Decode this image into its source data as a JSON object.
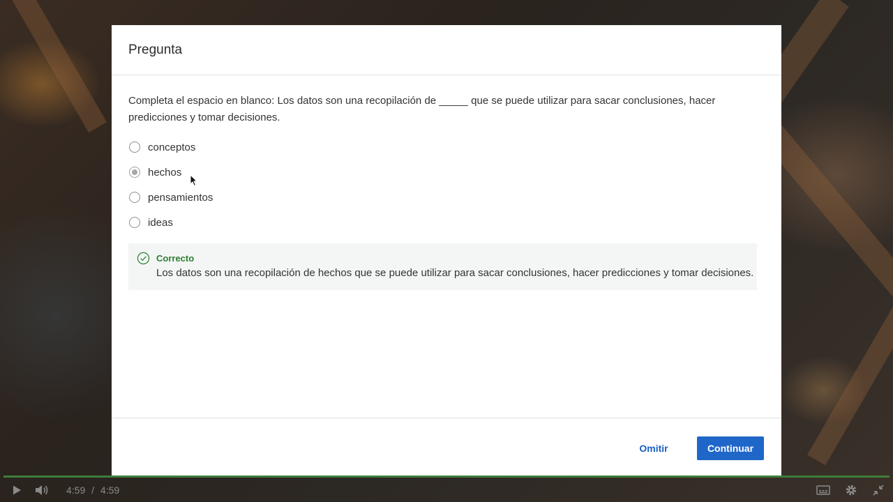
{
  "modal": {
    "title": "Pregunta",
    "question": "Completa el espacio en blanco: Los datos son una recopilación de _____ que se puede utilizar para sacar conclusiones, hacer predicciones y tomar decisiones.",
    "options": [
      {
        "label": "conceptos",
        "selected": false
      },
      {
        "label": "hechos",
        "selected": true
      },
      {
        "label": "pensamientos",
        "selected": false
      },
      {
        "label": "ideas",
        "selected": false
      }
    ],
    "feedback": {
      "title": "Correcto",
      "text": "Los datos son una recopilación de hechos que se puede utilizar para sacar conclusiones, hacer predicciones y tomar decisiones.",
      "icon": "check-circle-icon",
      "color": "#2e7d32"
    },
    "buttons": {
      "skip": "Omitir",
      "continue": "Continuar"
    }
  },
  "player": {
    "current_time": "4:59",
    "separator": "/",
    "duration": "4:59",
    "progress": 1.0,
    "icons": [
      "play-icon",
      "volume-icon",
      "captions-icon",
      "settings-icon",
      "exit-fullscreen-icon"
    ]
  },
  "colors": {
    "accent": "#1f66c9",
    "success": "#2e7d32",
    "progress": "#3f7d3a"
  }
}
